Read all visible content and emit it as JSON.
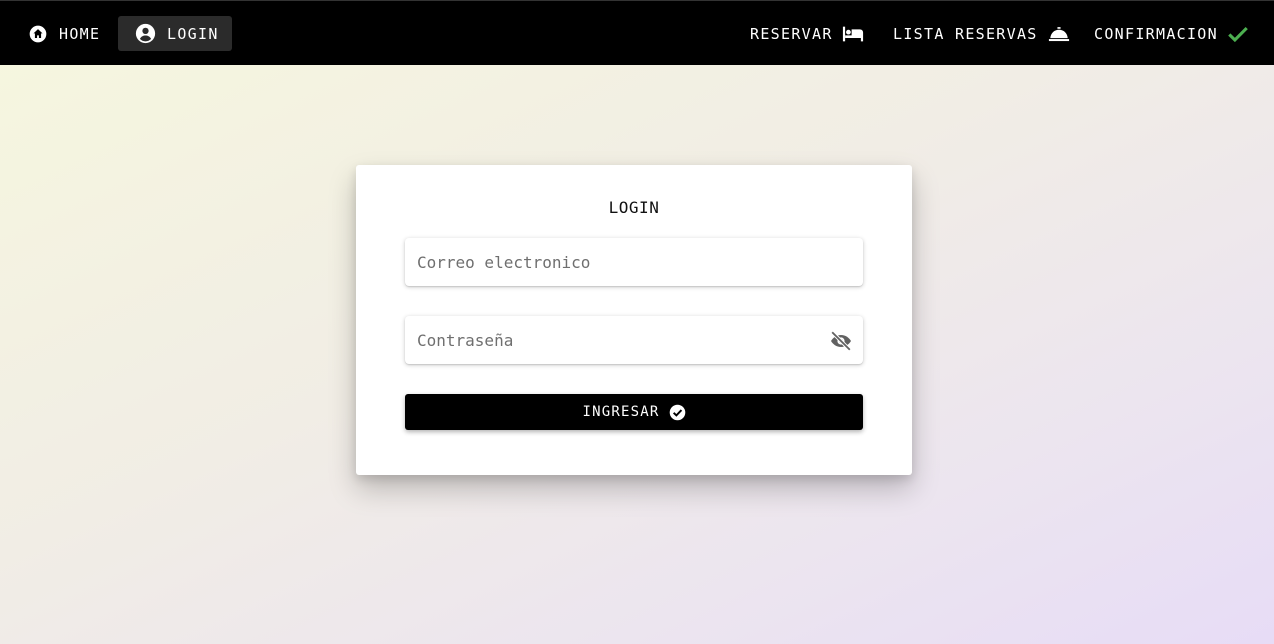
{
  "nav": {
    "home": {
      "label": "HOME",
      "icon": "home-icon"
    },
    "login": {
      "label": "LOGIN",
      "icon": "account-circle-icon",
      "active": true
    },
    "reservar": {
      "label": "RESERVAR",
      "icon": "bed-icon"
    },
    "lista": {
      "label": "LISTA RESERVAS",
      "icon": "room-service-icon"
    },
    "confirmacion": {
      "label": "CONFIRMACION",
      "icon": "check-icon",
      "icon_color": "#4caf50"
    }
  },
  "login_card": {
    "title": "LOGIN",
    "email_placeholder": "Correo electronico",
    "email_value": "",
    "password_placeholder": "Contraseña",
    "password_value": "",
    "password_toggle_icon": "eye-off-icon",
    "submit_label": "INGRESAR",
    "submit_icon": "check-circle-icon"
  },
  "colors": {
    "navbar": "#000000",
    "accent_check": "#4caf50",
    "button": "#000000"
  }
}
